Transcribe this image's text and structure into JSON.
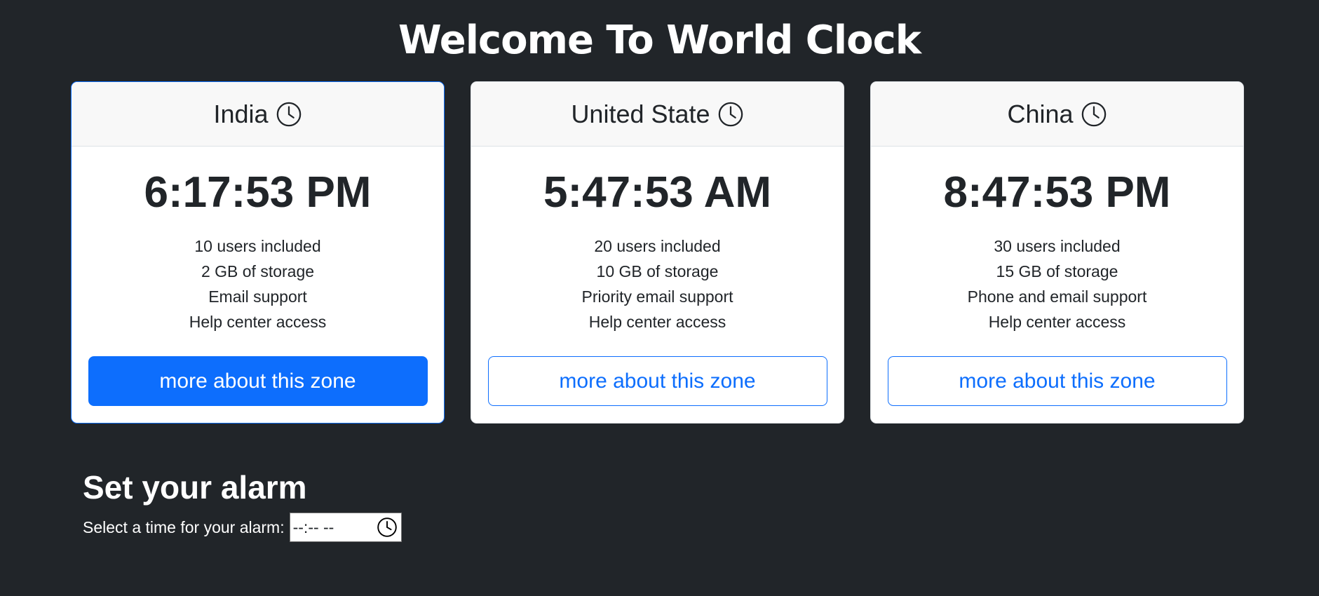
{
  "page": {
    "title": "Welcome To World Clock"
  },
  "cards": [
    {
      "zone": "India",
      "time": "6:17:53 PM",
      "features": [
        "10 users included",
        "2 GB of storage",
        "Email support",
        "Help center access"
      ],
      "button_label": "more about this zone"
    },
    {
      "zone": "United State",
      "time": "5:47:53 AM",
      "features": [
        "20 users included",
        "10 GB of storage",
        "Priority email support",
        "Help center access"
      ],
      "button_label": "more about this zone"
    },
    {
      "zone": "China",
      "time": "8:47:53 PM",
      "features": [
        "30 users included",
        "15 GB of storage",
        "Phone and email support",
        "Help center access"
      ],
      "button_label": "more about this zone"
    }
  ],
  "alarm": {
    "title": "Set your alarm",
    "label": "Select a time for your alarm:",
    "placeholder": "--:-- --"
  },
  "icons": {
    "clock": "clock-icon"
  },
  "colors": {
    "background": "#212529",
    "accent": "#0d6efd",
    "card_header": "#f8f8f8"
  }
}
